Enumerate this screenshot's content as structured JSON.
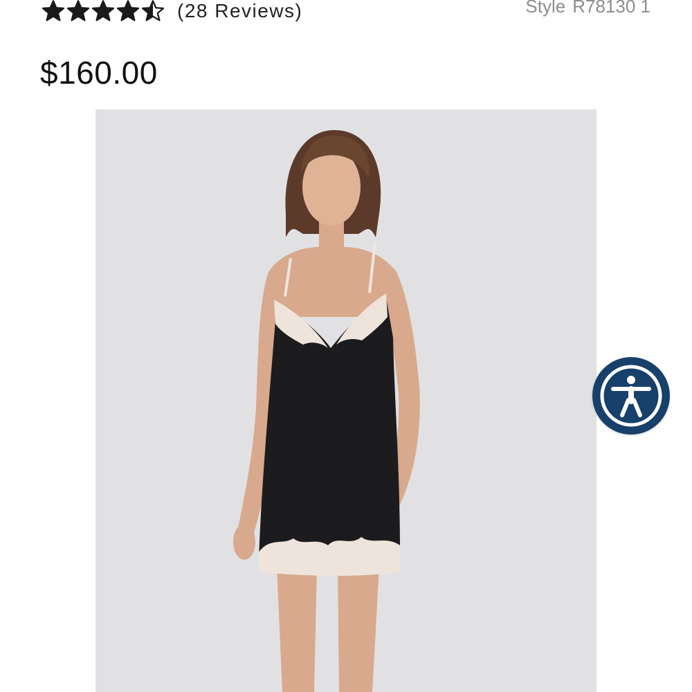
{
  "product": {
    "rating": 4.5,
    "rating_max": 5,
    "reviews_text": "(28 Reviews)",
    "style_label": "Style",
    "style_code": "R78130 1",
    "price": "$160.00",
    "image_icon": "product-photo"
  },
  "accessibility": {
    "icon": "accessibility-person-icon"
  },
  "colors": {
    "star": "#1a1a1a",
    "style_text": "#8c8c8c",
    "image_bg": "#e1e1e3",
    "accessibility_bg": "#17406b"
  }
}
